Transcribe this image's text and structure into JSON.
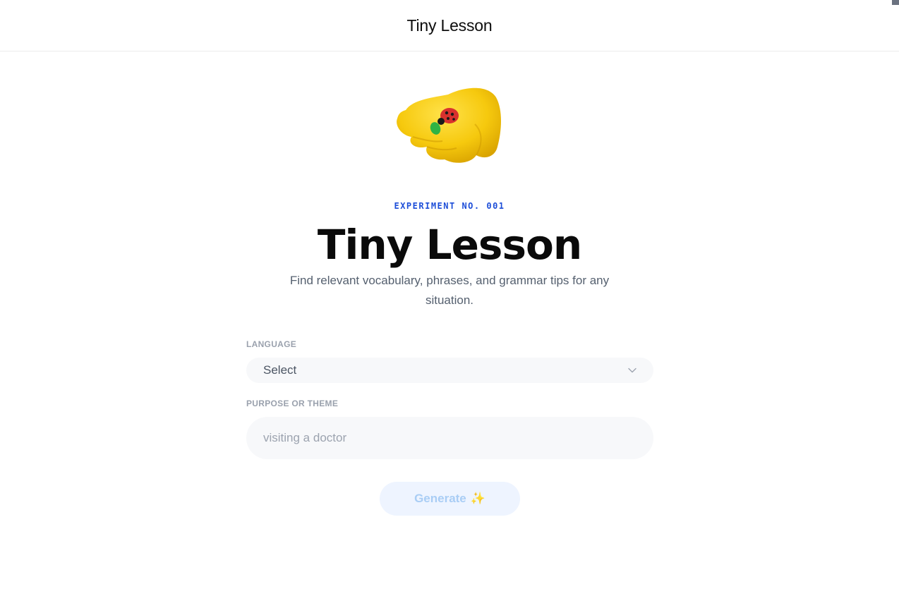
{
  "header": {
    "title": "Tiny Lesson"
  },
  "hero": {
    "kicker": "EXPERIMENT NO. 001",
    "title": "Tiny Lesson",
    "subtitle": "Find relevant vocabulary, phrases, and grammar tips for any situation.",
    "image_icon": "yellow-hand-with-ladybug-icon"
  },
  "form": {
    "language": {
      "label": "LANGUAGE",
      "value": "Select",
      "icon": "chevron-down-icon"
    },
    "purpose": {
      "label": "PURPOSE OR THEME",
      "value": "",
      "placeholder": "visiting a doctor"
    },
    "generate": {
      "label": "Generate",
      "icon": "sparkles-icon",
      "glyph": "✨"
    }
  },
  "colors": {
    "accent": "#1d4ed8",
    "button_bg": "#eef4ff",
    "button_text": "#a9cdf5",
    "field_bg": "#f7f8fa",
    "label_gray": "#9aa1ad"
  }
}
